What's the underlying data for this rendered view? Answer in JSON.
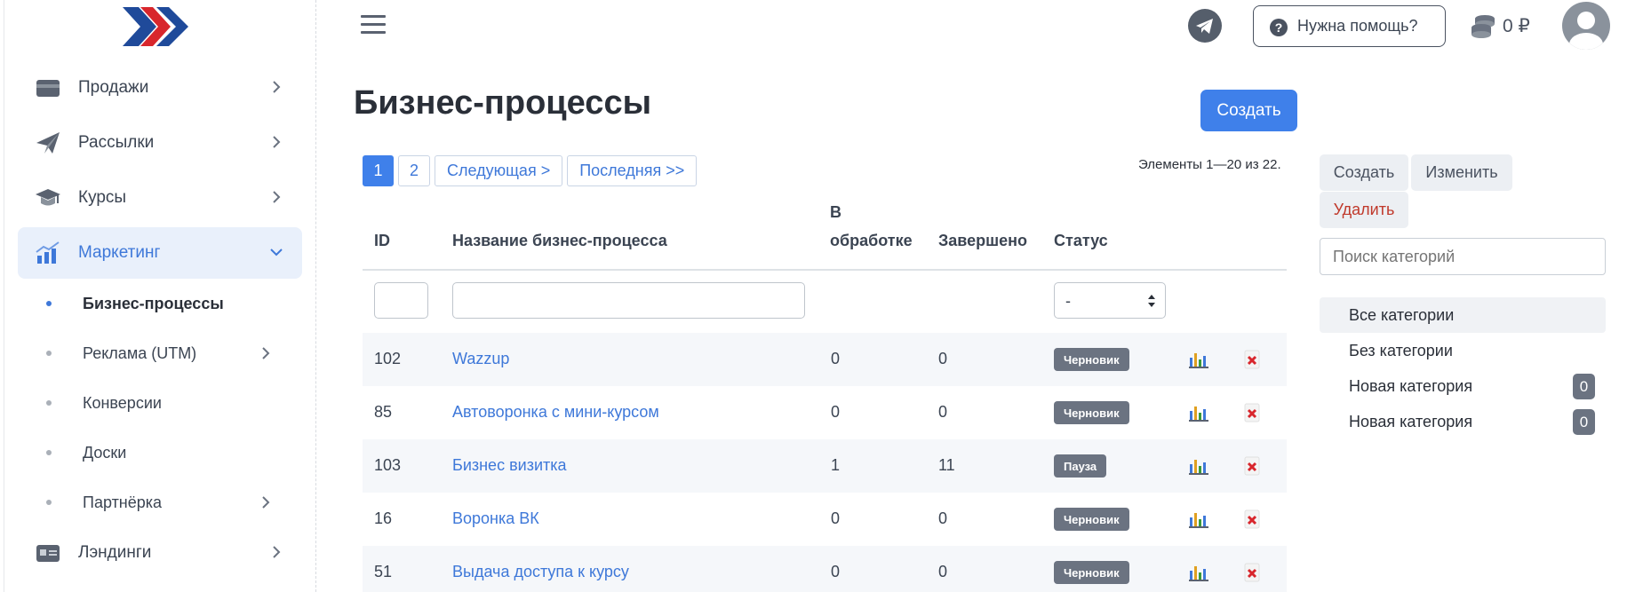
{
  "sidebar": {
    "items": [
      {
        "label": "Продажи",
        "icon": "wallet-icon"
      },
      {
        "label": "Рассылки",
        "icon": "paper-plane-icon"
      },
      {
        "label": "Курсы",
        "icon": "graduation-cap-icon"
      },
      {
        "label": "Маркетинг",
        "icon": "chart-growth-icon",
        "expanded": true
      },
      {
        "label": "Лэндинги",
        "icon": "id-card-icon"
      }
    ],
    "sub_items": [
      {
        "label": "Бизнес-процессы",
        "active": true
      },
      {
        "label": "Реклама (UTM)"
      },
      {
        "label": "Конверсии"
      },
      {
        "label": "Доски"
      },
      {
        "label": "Партнёрка"
      }
    ],
    "logo_colors": [
      "#1f4a9a",
      "#d8262c"
    ]
  },
  "header": {
    "help_label": "Нужна помощь?",
    "help_icon": "?",
    "balance": "0 ₽"
  },
  "main": {
    "title": "Бизнес-процессы",
    "create_label": "Создать",
    "pager": [
      "1",
      "2",
      "Следующая >",
      "Последняя >>"
    ],
    "elements_info": "Элементы 1—20 из 22.",
    "table": {
      "headers": {
        "id": "ID",
        "name": "Название бизнес-процесса",
        "processing_1": "В",
        "processing_2": "обработке",
        "done": "Завершено",
        "status": "Статус"
      },
      "status_filter_value": "-",
      "rows": [
        {
          "id": "102",
          "name": "Wazzup",
          "processing": "0",
          "done": "0",
          "status": "Черновик"
        },
        {
          "id": "85",
          "name": "Автоворонка с мини-курсом",
          "processing": "0",
          "done": "0",
          "status": "Черновик"
        },
        {
          "id": "103",
          "name": "Бизнес визитка",
          "processing": "1",
          "done": "11",
          "status": "Пауза"
        },
        {
          "id": "16",
          "name": "Воронка ВК",
          "processing": "0",
          "done": "0",
          "status": "Черновик"
        },
        {
          "id": "51",
          "name": "Выдача доступа к курсу",
          "processing": "0",
          "done": "0",
          "status": "Черновик"
        }
      ]
    }
  },
  "categories": {
    "create_label": "Создать",
    "edit_label": "Изменить",
    "delete_label": "Удалить",
    "search_placeholder": "Поиск категорий",
    "items": [
      {
        "label": "Все категории",
        "selected": true
      },
      {
        "label": "Без категории"
      },
      {
        "label": "Новая категория",
        "count": "0"
      },
      {
        "label": "Новая категория",
        "count": "0"
      }
    ]
  },
  "colors": {
    "accent": "#3f80ea",
    "link": "#3e78d9",
    "delete_text": "#c0392b",
    "badge": "#6b7381"
  }
}
